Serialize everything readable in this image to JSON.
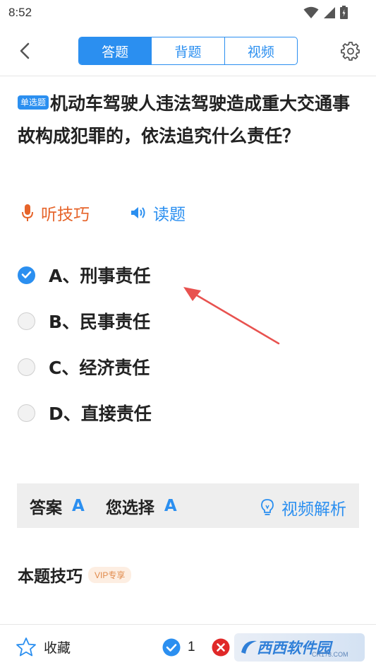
{
  "status_bar": {
    "time": "8:52"
  },
  "header": {
    "tabs": [
      {
        "label": "答题",
        "active": true
      },
      {
        "label": "背题",
        "active": false
      },
      {
        "label": "视频",
        "active": false
      }
    ]
  },
  "question": {
    "type_badge": "单选题",
    "text": "机动车驾驶人违法驾驶造成重大交通事故构成犯罪的，依法追究什么责任？"
  },
  "tips": {
    "listen_label": "听技巧",
    "read_label": "读题"
  },
  "options": [
    {
      "label": "A、刑事责任",
      "selected": true
    },
    {
      "label": "B、民事责任",
      "selected": false
    },
    {
      "label": "C、经济责任",
      "selected": false
    },
    {
      "label": "D、直接责任",
      "selected": false
    }
  ],
  "answer_bar": {
    "answer_label": "答案",
    "answer_value": "A",
    "choice_label": "您选择",
    "choice_value": "A",
    "video_label": "视频解析"
  },
  "tip_section": {
    "title": "本题技巧",
    "vip_badge": "VIP专享"
  },
  "bottom_bar": {
    "favorite_label": "收藏",
    "correct_count": "1",
    "watermark_text": "西西软件园",
    "watermark_sub": "CR173.COM"
  },
  "colors": {
    "accent": "#2b8ff0",
    "listen": "#e6642a",
    "wrong": "#e02828",
    "annotation_arrow": "#e8524f"
  }
}
